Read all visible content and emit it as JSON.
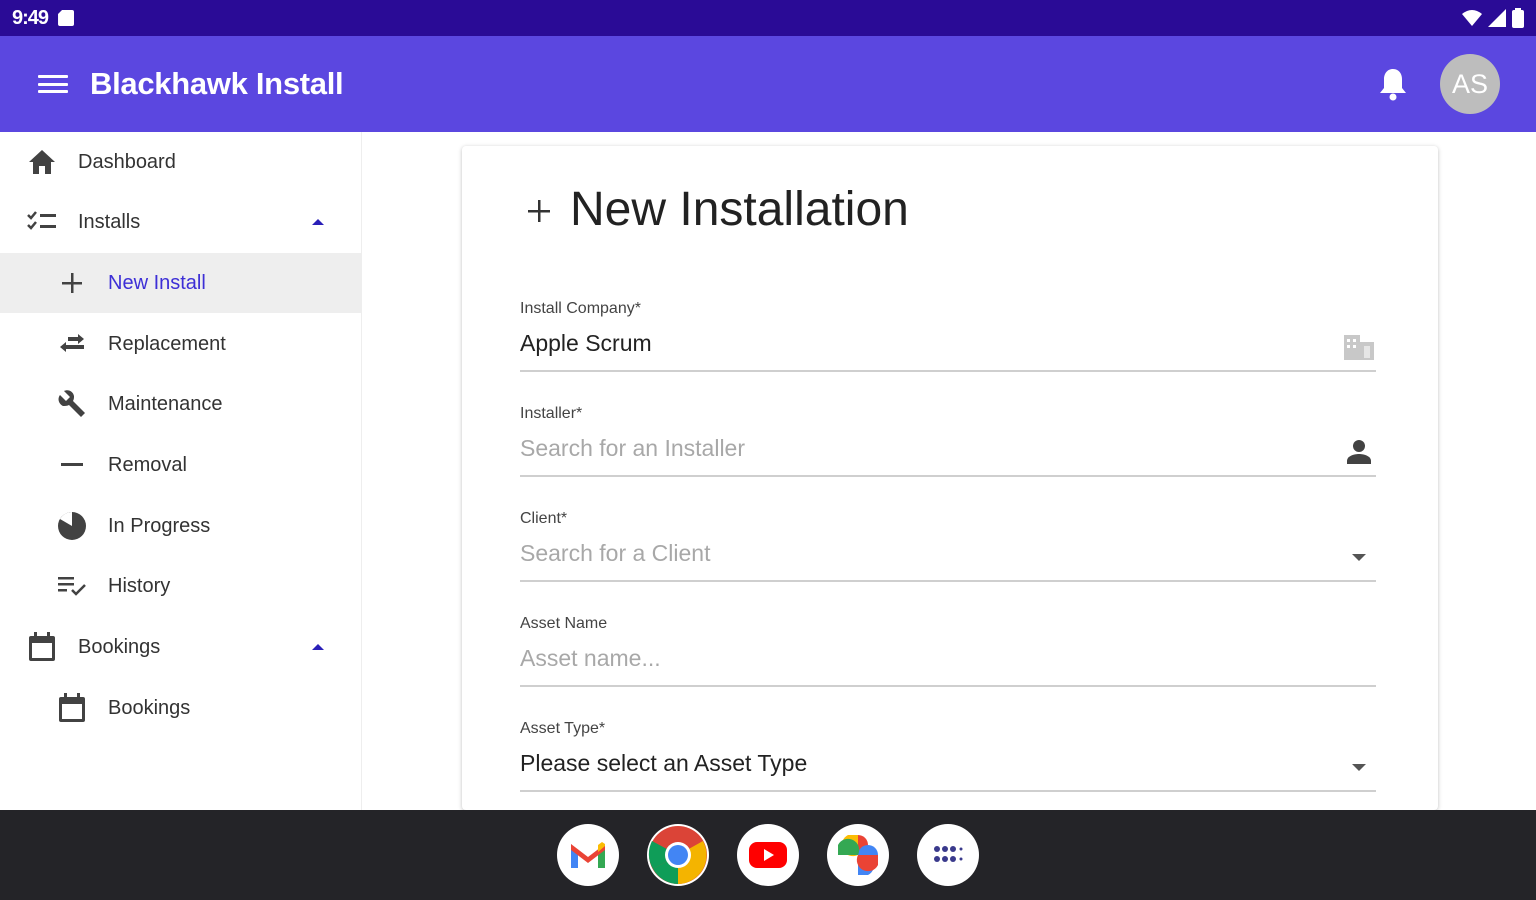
{
  "status_bar": {
    "time": "9:49"
  },
  "app_bar": {
    "title": "Blackhawk Install",
    "avatar_initials": "AS"
  },
  "sidebar": {
    "items": [
      {
        "label": "Dashboard",
        "icon": "home-icon"
      },
      {
        "label": "Installs",
        "icon": "checklist-icon",
        "expanded": true
      },
      {
        "label": "New Install",
        "icon": "plus-icon",
        "active": true
      },
      {
        "label": "Replacement",
        "icon": "swap-icon"
      },
      {
        "label": "Maintenance",
        "icon": "wrench-icon"
      },
      {
        "label": "Removal",
        "icon": "minus-icon"
      },
      {
        "label": "In Progress",
        "icon": "pie-icon"
      },
      {
        "label": "History",
        "icon": "history-icon"
      },
      {
        "label": "Bookings",
        "icon": "calendar-icon",
        "expanded": true
      },
      {
        "label": "Bookings",
        "icon": "calendar-icon"
      }
    ]
  },
  "form": {
    "title": "New Installation",
    "fields": [
      {
        "label": "Install Company*",
        "value": "Apple Scrum",
        "placeholder": "",
        "icon": "company-icon"
      },
      {
        "label": "Installer*",
        "value": "",
        "placeholder": "Search for an Installer",
        "icon": "person-icon"
      },
      {
        "label": "Client*",
        "value": "",
        "placeholder": "Search for a Client",
        "icon": "chevron-down-icon"
      },
      {
        "label": "Asset Name",
        "value": "",
        "placeholder": "Asset name...",
        "icon": ""
      },
      {
        "label": "Asset Type*",
        "value": "Please select an Asset Type",
        "placeholder": "",
        "icon": "chevron-down-icon"
      }
    ]
  },
  "dock": {
    "apps": [
      {
        "name": "Gmail",
        "icon": "gmail-icon"
      },
      {
        "name": "Chrome",
        "icon": "chrome-icon"
      },
      {
        "name": "YouTube",
        "icon": "youtube-icon"
      },
      {
        "name": "Photos",
        "icon": "photos-icon"
      },
      {
        "name": "All apps",
        "icon": "apps-icon"
      }
    ]
  },
  "colors": {
    "app_bar": "#5b47e0",
    "status_bar": "#2a0b96",
    "accent": "#3d2fd6",
    "taskbar": "#242428"
  }
}
